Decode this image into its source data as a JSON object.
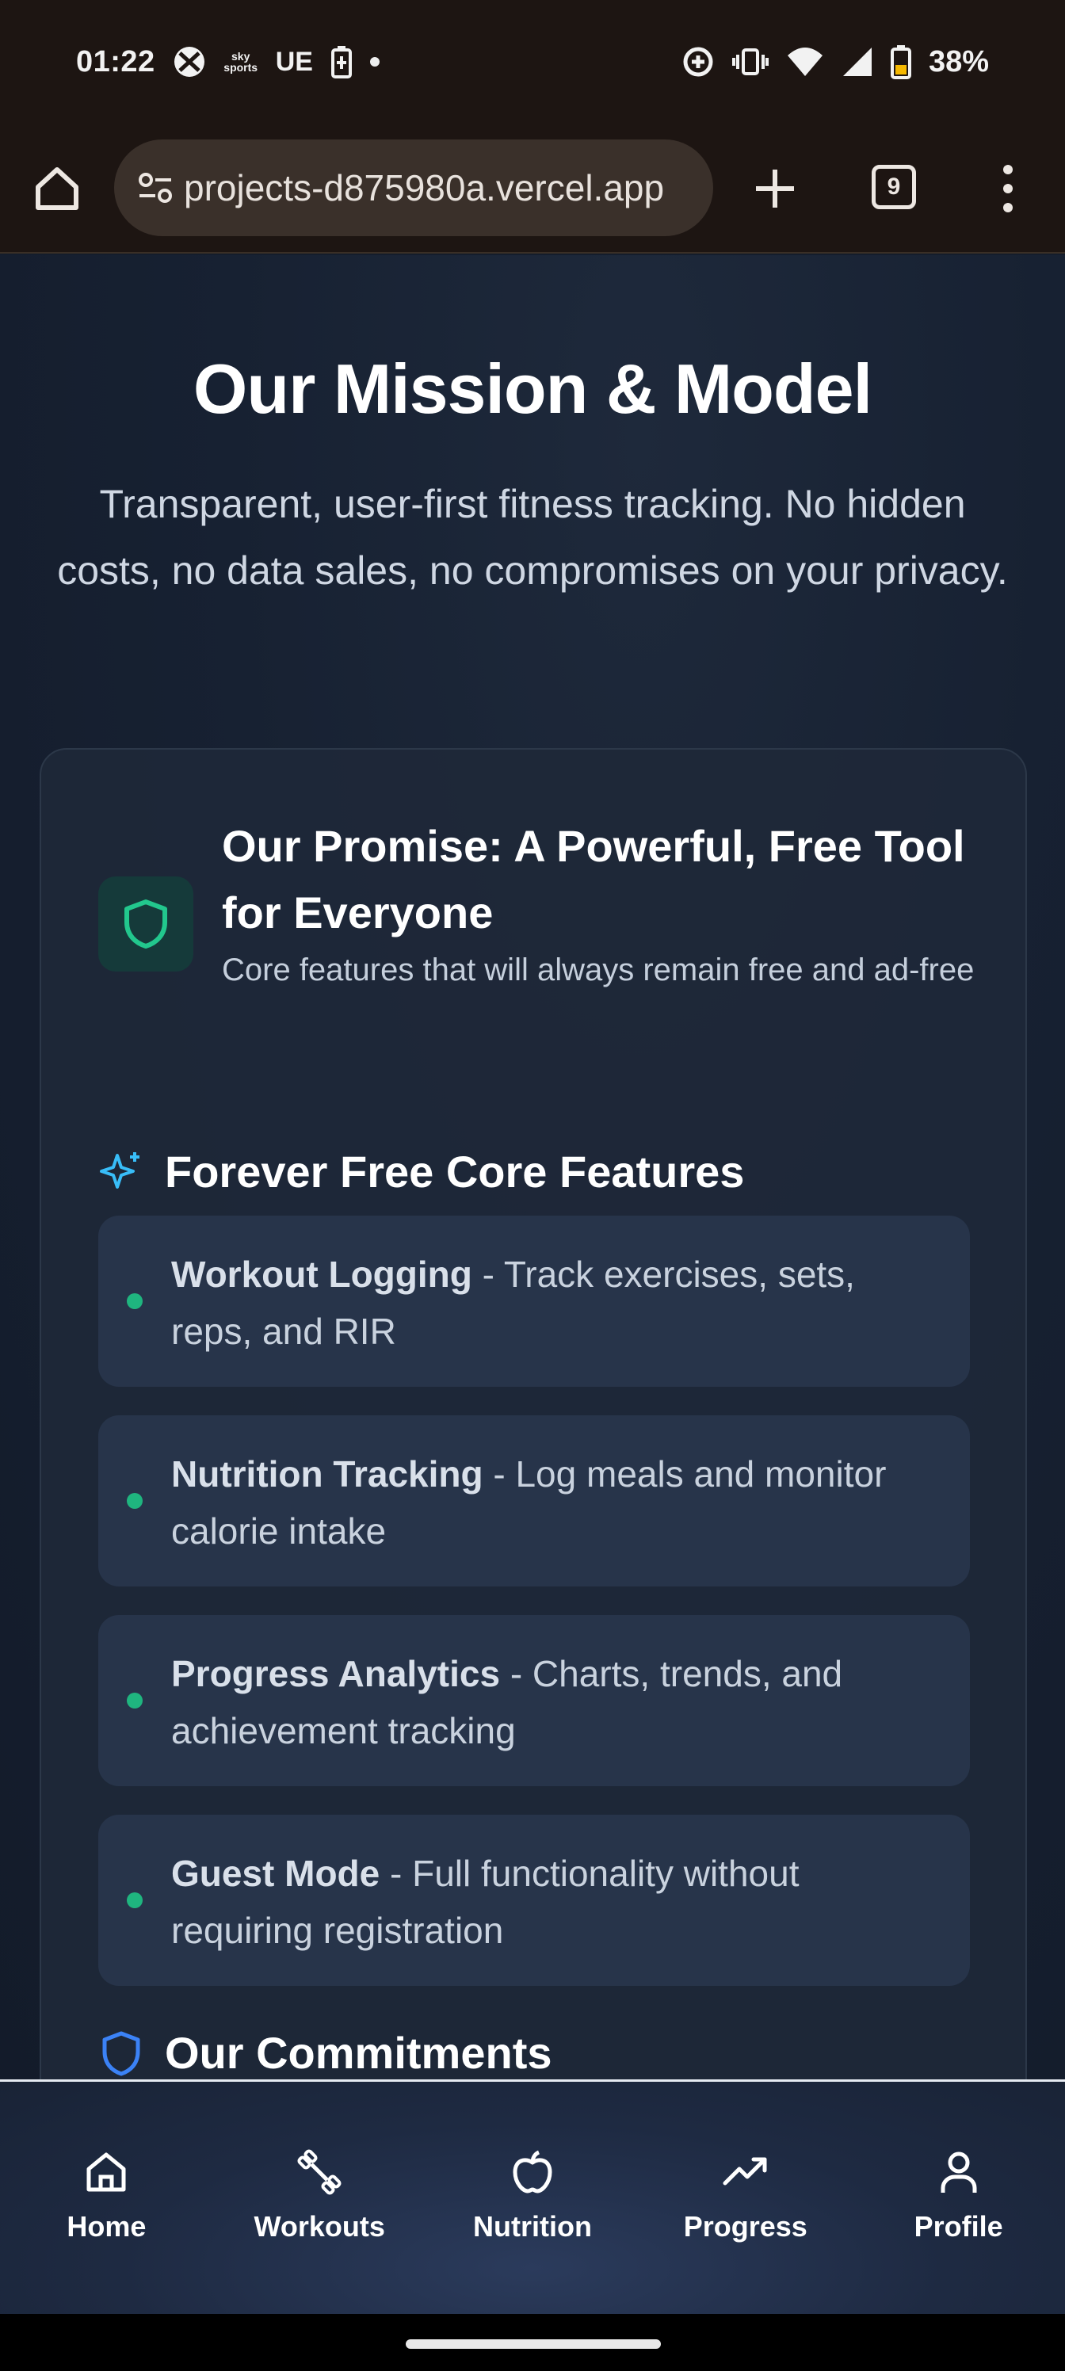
{
  "status_bar": {
    "time": "01:22",
    "sky_sports_label": "sky sports",
    "ue_label": "UE",
    "battery_percent": "38%"
  },
  "browser": {
    "url": "projects-d875980a.vercel.app",
    "tab_count": "9"
  },
  "hero": {
    "title": "Our Mission & Model",
    "subtitle": "Transparent, user-first fitness tracking. No hidden costs, no data sales, no compromises on your privacy."
  },
  "promise": {
    "title": "Our Promise: A Powerful, Free Tool for Everyone",
    "description": "Core features that will always remain free and ad-free"
  },
  "features_section": {
    "heading": "Forever Free Core Features",
    "items": [
      {
        "name": "Workout Logging",
        "desc": " - Track exercises, sets, reps, and RIR"
      },
      {
        "name": "Nutrition Tracking",
        "desc": " - Log meals and monitor calorie intake"
      },
      {
        "name": "Progress Analytics",
        "desc": " - Charts, trends, and achievement tracking"
      },
      {
        "name": "Guest Mode",
        "desc": " - Full functionality without requiring registration"
      }
    ]
  },
  "commitments_section": {
    "heading": "Our Commitments"
  },
  "bottom_nav": {
    "items": [
      {
        "label": "Home",
        "icon": "home-icon"
      },
      {
        "label": "Workouts",
        "icon": "dumbbell-icon"
      },
      {
        "label": "Nutrition",
        "icon": "apple-icon"
      },
      {
        "label": "Progress",
        "icon": "trending-up-icon"
      },
      {
        "label": "Profile",
        "icon": "user-icon"
      }
    ]
  },
  "colors": {
    "accent_green": "#1fb57f",
    "accent_cyan": "#38bdf8",
    "accent_blue": "#3b82f6",
    "background": "#141d2c"
  }
}
